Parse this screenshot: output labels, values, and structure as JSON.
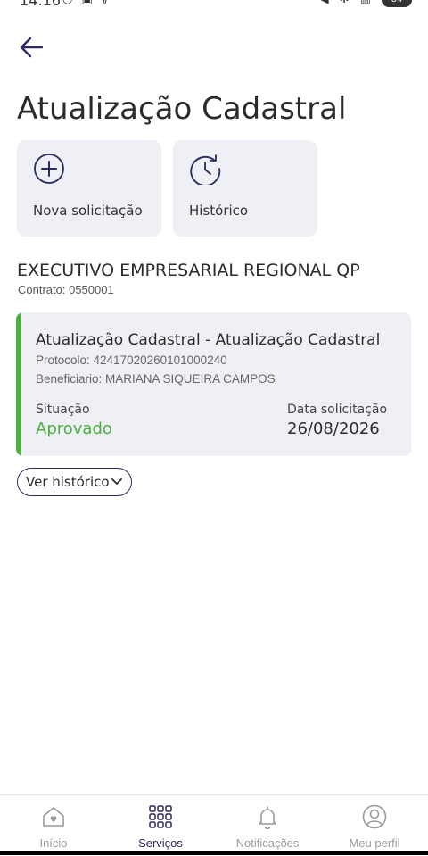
{
  "status_bar": {
    "time": "14:16",
    "battery": "84"
  },
  "page": {
    "title": "Atualização Cadastral"
  },
  "quick_actions": [
    {
      "label": "Nova solicitação",
      "icon": "plus-circle-icon"
    },
    {
      "label": "Histórico",
      "icon": "history-clock-icon"
    }
  ],
  "company": {
    "name": "EXECUTIVO EMPRESARIAL REGIONAL QP",
    "contract": "Contrato: 0550001"
  },
  "request": {
    "title": "Atualização Cadastral - Atualização Cadastral",
    "protocol": "Protocolo: 42417020260101000240",
    "beneficiary": "Beneficiario: MARIANA SIQUEIRA CAMPOS",
    "status_label": "Situação",
    "status_value": "Aprovado",
    "date_label": "Data solicitação",
    "date_value": "26/08/2026",
    "accent_color": "#4caf3e"
  },
  "history_button": {
    "label": "Ver histórico"
  },
  "bottom_nav": {
    "items": [
      {
        "label": "Início",
        "icon": "home-heart-icon",
        "active": false
      },
      {
        "label": "Serviços",
        "icon": "grid-icon",
        "active": true
      },
      {
        "label": "Notificações",
        "icon": "bell-icon",
        "active": false
      },
      {
        "label": "Meu perfil",
        "icon": "profile-icon",
        "active": false
      }
    ]
  },
  "colors": {
    "primary": "#2d2a5e",
    "card_bg": "#efeff6",
    "success": "#4caf3e",
    "inactive": "#9a9a9a"
  }
}
